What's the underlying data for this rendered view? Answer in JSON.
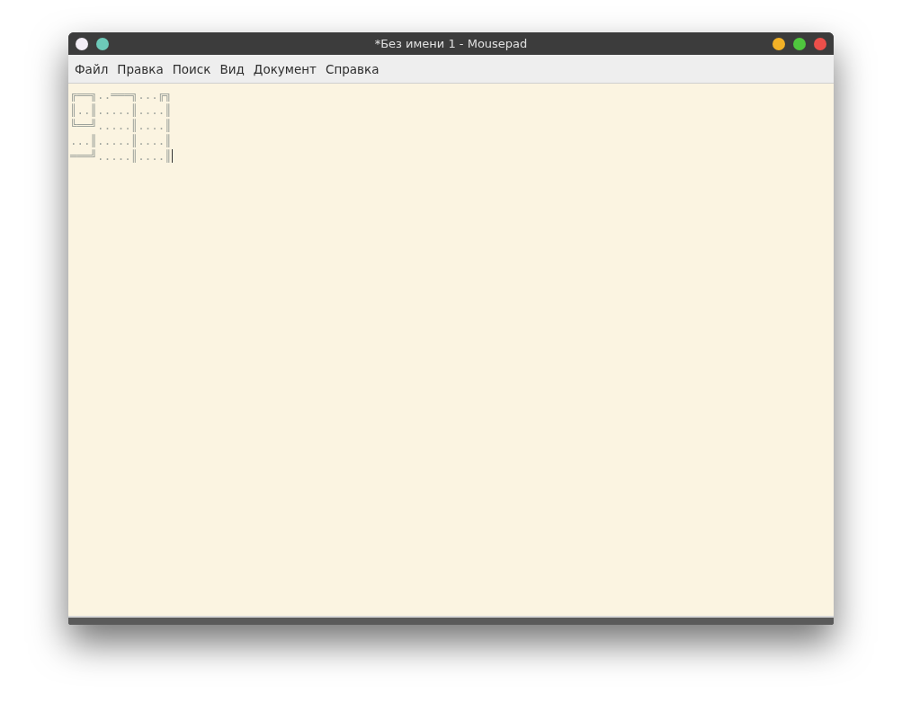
{
  "window": {
    "title": "*Без имени 1 - Mousepad"
  },
  "menu": [
    "Файл",
    "Правка",
    "Поиск",
    "Вид",
    "Документ",
    "Справка"
  ],
  "editor": {
    "lines": [
      "╔══╗..═══╗...╔╗",
      "║..║.....║....║",
      "╚══╝.....║....║",
      "...║.....║....║",
      "═══╝.....║....║"
    ]
  }
}
